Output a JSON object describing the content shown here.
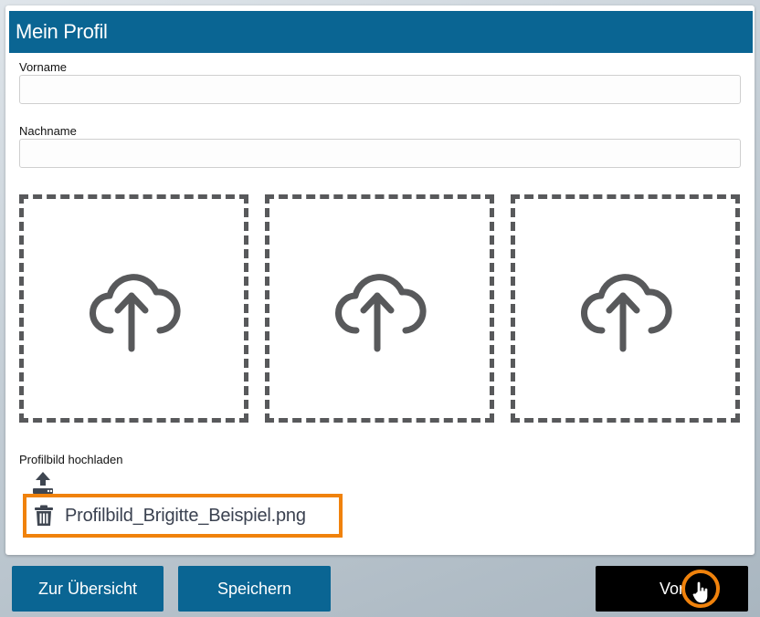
{
  "header": {
    "title": "Mein Profil"
  },
  "form": {
    "first_name": {
      "label": "Vorname",
      "value": "",
      "placeholder": ""
    },
    "last_name": {
      "label": "Nachname",
      "value": "",
      "placeholder": ""
    }
  },
  "upload_slots": [
    {
      "icon": "cloud-upload-icon"
    },
    {
      "icon": "cloud-upload-icon"
    },
    {
      "icon": "cloud-upload-icon"
    }
  ],
  "profile_picture": {
    "label": "Profilbild hochladen",
    "upload_icon": "upload-icon",
    "delete_icon": "trash-icon",
    "file_name": "Profilbild_Brigitte_Beispiel.png"
  },
  "footer": {
    "overview_label": "Zur Übersicht",
    "save_label": "Speichern",
    "next_label": "Vor"
  },
  "colors": {
    "primary": "#0a6593",
    "highlight": "#f0820c",
    "icon": "#58595b",
    "next_button": "#000000"
  }
}
